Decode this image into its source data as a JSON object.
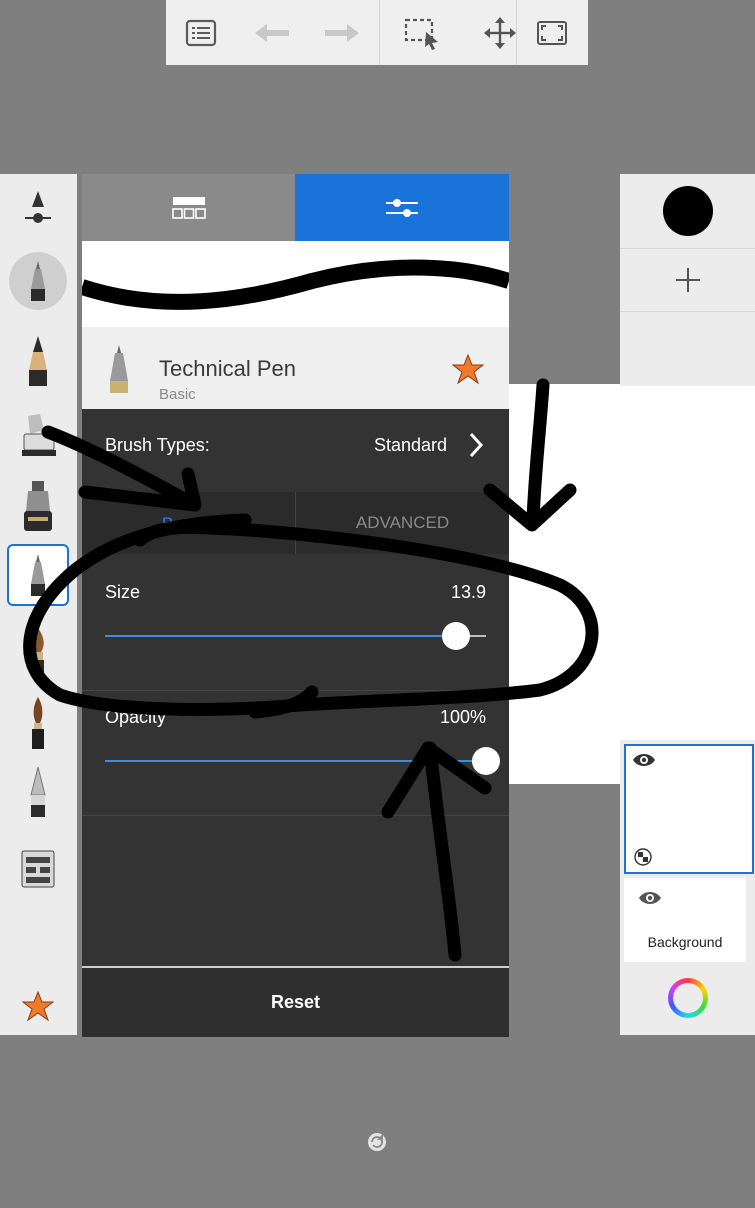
{
  "toolbar": {
    "icons": [
      "list-icon",
      "undo-icon",
      "redo-icon",
      "selection-icon",
      "move-icon",
      "fullscreen-icon"
    ]
  },
  "brush_panel": {
    "tabs": [
      "brush-library-icon",
      "brush-settings-icon"
    ],
    "brush_name": "Technical Pen",
    "brush_category": "Basic",
    "favorite": true,
    "brush_types_label": "Brush Types:",
    "brush_type_value": "Standard",
    "segments": [
      "B",
      "ADVANCED"
    ],
    "size": {
      "label": "Size",
      "value_text": "13.9",
      "fraction": 0.92
    },
    "opacity": {
      "label": "Opacity",
      "value_text": "100%",
      "fraction": 1.0
    },
    "reset_label": "Reset"
  },
  "layers": {
    "current_color": "#000000",
    "items": [
      {
        "label": "",
        "visible": true,
        "selected": true
      },
      {
        "label": "Background",
        "visible": true,
        "selected": false
      }
    ]
  },
  "colors": {
    "accent": "#1a73d9",
    "favorite": "#f07a2a",
    "panel": "#333333"
  }
}
